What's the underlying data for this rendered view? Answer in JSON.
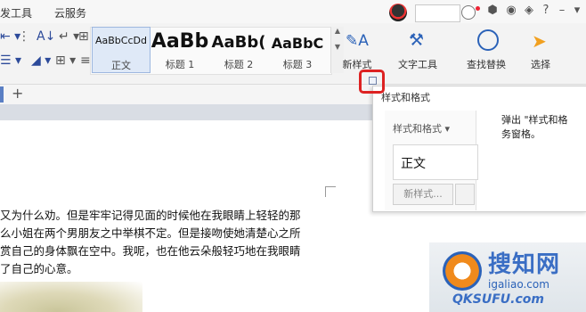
{
  "menubar": {
    "items": [
      "发工具",
      "云服务"
    ]
  },
  "ribbon": {
    "styles": [
      {
        "preview": "AaBbCcDd",
        "label": "正文",
        "selected": true
      },
      {
        "preview": "AaBb",
        "label": "标题 1",
        "selected": false
      },
      {
        "preview": "AaBb(",
        "label": "标题 2",
        "selected": false
      },
      {
        "preview": "AaBbC",
        "label": "标题 3",
        "selected": false
      }
    ],
    "new_style": "新样式",
    "text_tools": "文字工具",
    "find_replace": "查找替换",
    "select": "选择"
  },
  "tabrow": {
    "add": "+"
  },
  "pane": {
    "title": "样式和格式",
    "dropdown": "样式和格式 ▾",
    "current_style": "正文",
    "new_style_button": "新样式...",
    "tooltip_line1": "弹出 \"样式和格",
    "tooltip_line2": "务窗格。"
  },
  "document": {
    "lines": [
      "又为什么劝。但是牢牢记得见面的时候他在我眼睛上轻轻的那",
      "么小姐在两个男朋友之中举棋不定。但是接吻使她清楚心之所",
      "赏自己的身体飘在空中。我呢，也在他云朵般轻巧地在我眼睛",
      "了自己的心意。"
    ]
  },
  "watermark": {
    "top": "搜知网",
    "site1": "igaliao.com",
    "site2": "QKSUFU.com"
  },
  "colors": {
    "highlight_red": "#dd2222",
    "accent_blue": "#2b62b8"
  }
}
